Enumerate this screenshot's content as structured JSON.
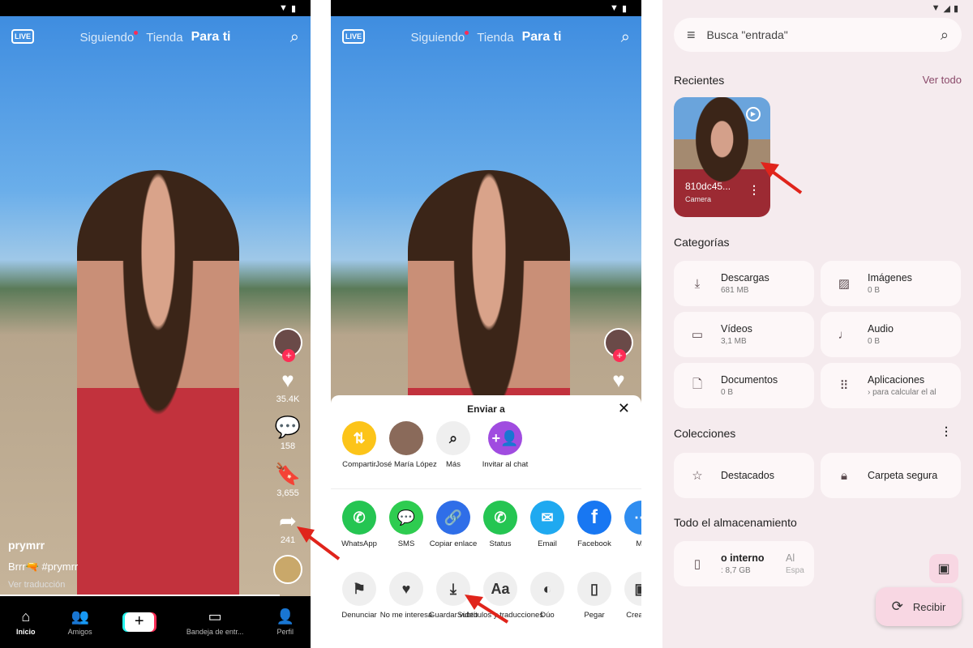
{
  "tiktok": {
    "live_label": "LIVE",
    "tabs": [
      "Siguiendo",
      "Tienda",
      "Para ti"
    ],
    "likes": "35.4K",
    "comments": "158",
    "saves": "3,655",
    "shares": "241",
    "username": "prymrr",
    "caption": "Brrr🔫 #prymrr",
    "translate": "Ver traducción",
    "nav": [
      "Inicio",
      "Amigos",
      "+",
      "Bandeja de entr...",
      "Perfil"
    ],
    "video_progress": 0.9
  },
  "share_sheet": {
    "title": "Enviar a",
    "row1": [
      {
        "label": "Compartir",
        "color": "#fcc419"
      },
      {
        "label": "José María López",
        "color": "#8a6a5a"
      },
      {
        "label": "Más",
        "color": "#efefef"
      },
      {
        "label": "Invitar al chat",
        "color": "#a04ce0"
      }
    ],
    "row2": [
      {
        "label": "WhatsApp",
        "color": "#25c552"
      },
      {
        "label": "SMS",
        "color": "#2ecc50"
      },
      {
        "label": "Copiar enlace",
        "color": "#2f6ee8"
      },
      {
        "label": "Status",
        "color": "#25c552"
      },
      {
        "label": "Email",
        "color": "#1fa9f0"
      },
      {
        "label": "Facebook",
        "color": "#1877f2"
      },
      {
        "label": "Ma",
        "color": "#2f8df0"
      }
    ],
    "row3": [
      {
        "label": "Denunciar"
      },
      {
        "label": "No me interesa"
      },
      {
        "label": "Guardar video"
      },
      {
        "label": "Subtítulos y traducciones"
      },
      {
        "label": "Dúo"
      },
      {
        "label": "Pegar"
      },
      {
        "label": "Crea stic"
      }
    ]
  },
  "files": {
    "search_placeholder": "Busca \"entrada\"",
    "recent_title": "Recientes",
    "see_all": "Ver todo",
    "recent_item": {
      "name": "810dc45...",
      "source": "Camera"
    },
    "categories_title": "Categorías",
    "categories": [
      {
        "name": "Descargas",
        "size": "681 MB"
      },
      {
        "name": "Imágenes",
        "size": "0 B"
      },
      {
        "name": "Vídeos",
        "size": "3,1 MB"
      },
      {
        "name": "Audio",
        "size": "0 B"
      },
      {
        "name": "Documentos",
        "size": "0 B"
      },
      {
        "name": "Aplicaciones",
        "size": "› para calcular el al"
      }
    ],
    "collections_title": "Colecciones",
    "collections": [
      "Destacados",
      "Carpeta segura"
    ],
    "storage_title": "Todo el almacenamiento",
    "storage": {
      "name": "o interno",
      "free": ": 8,7 GB",
      "extra": "Al",
      "extra_sub": "Espa"
    },
    "receive": "Recibir",
    "accent": "#8a4a6a"
  }
}
